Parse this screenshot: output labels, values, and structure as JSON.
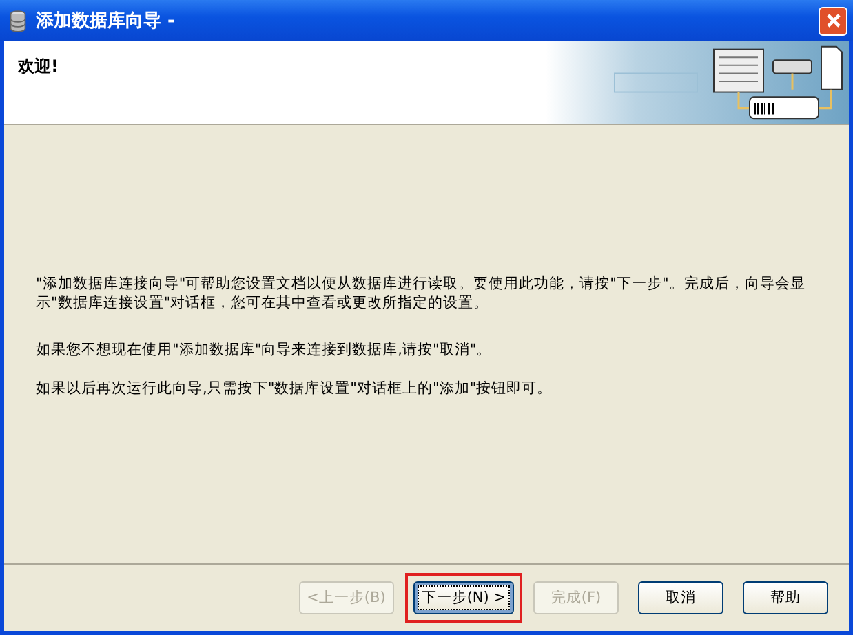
{
  "window": {
    "title": "添加数据库向导 -"
  },
  "header": {
    "title": "欢迎!"
  },
  "paragraphs": [
    "\"添加数据库连接向导\"可帮助您设置文档以便从数据库进行读取。要使用此功能，请按\"下一步\"。完成后，向导会显示\"数据库连接设置\"对话框，您可在其中查看或更改所指定的设置。",
    "如果您不想现在使用\"添加数据库\"向导来连接到数据库,请按\"取消\"。",
    "如果以后再次运行此向导,只需按下\"数据库设置\"对话框上的\"添加\"按钮即可。"
  ],
  "buttons": [
    {
      "label": "<上一步(B)",
      "disabled": true,
      "focused": false,
      "highlighted": false
    },
    {
      "label": "下一步(N) >",
      "disabled": false,
      "focused": true,
      "highlighted": true
    },
    {
      "label": "完成(F)",
      "disabled": true,
      "focused": false,
      "highlighted": false
    },
    {
      "label": "取消",
      "disabled": false,
      "focused": false,
      "highlighted": false
    },
    {
      "label": "帮助",
      "disabled": false,
      "focused": false,
      "highlighted": false
    }
  ]
}
